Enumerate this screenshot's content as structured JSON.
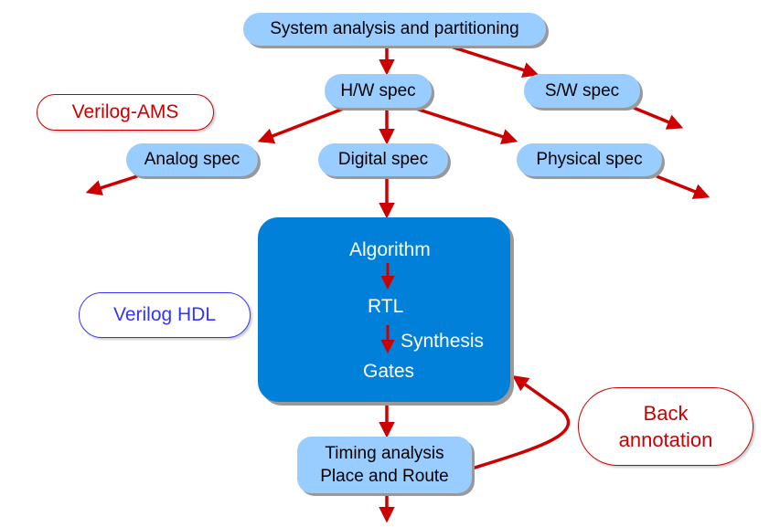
{
  "nodes": {
    "system": "System analysis and partitioning",
    "hw": "H/W spec",
    "sw": "S/W spec",
    "analog": "Analog spec",
    "digital": "Digital spec",
    "physical": "Physical spec",
    "timing_line1": "Timing analysis",
    "timing_line2": "Place and Route"
  },
  "inner": {
    "algorithm": "Algorithm",
    "rtl": "RTL",
    "synthesis": "Synthesis",
    "gates": "Gates"
  },
  "labels": {
    "verilog_ams": "Verilog-AMS",
    "verilog_hdl": "Verilog HDL",
    "back_line1": "Back",
    "back_line2": "annotation"
  },
  "colors": {
    "arrow": "#cc0000",
    "pill": "#99ccff",
    "block": "#0080d8",
    "hdl": "#3333ff"
  }
}
